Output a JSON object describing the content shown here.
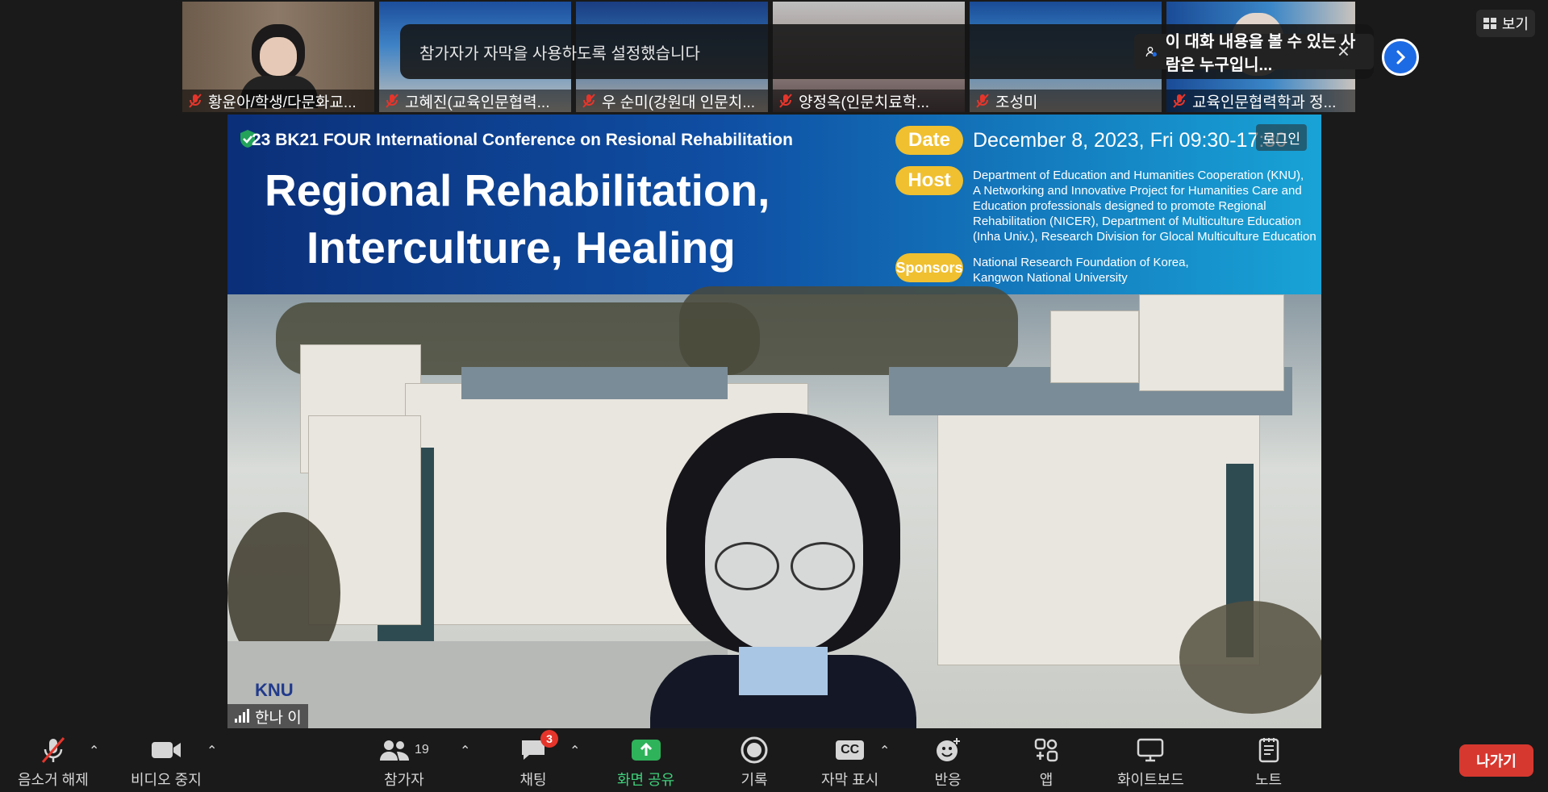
{
  "gallery": [
    {
      "name": "황윤아/학생/다문화교..."
    },
    {
      "name": "고혜진(교육인문협력..."
    },
    {
      "name": "우 순미(강원대 인문치..."
    },
    {
      "name": "양정옥(인문치료학..."
    },
    {
      "name": "조성미"
    },
    {
      "name": "교육인문협력학과 정..."
    }
  ],
  "caption_banner": {
    "text": "참가자가 자막을 사용하도록 설정했습니다",
    "who_can_see": "이 대화 내용을 볼 수 있는 사람은 누구입니...",
    "close": "×"
  },
  "view_button": {
    "label": "보기"
  },
  "shared_screen": {
    "conference": "23 BK21 FOUR International Conference on Resional Rehabilitation",
    "title_line1": "Regional Rehabilitation,",
    "title_line2": "Interculture, Healing",
    "date_tag": "Date",
    "date_text": "December 8, 2023, Fri 09:30-17:30",
    "host_tag": "Host",
    "host_text_1": "Department of Education and Humanities Cooperation (KNU),",
    "host_text_2": "A Networking and Innovative Project for Humanities Care and",
    "host_text_3": "Education professionals designed to promote Regional",
    "host_text_4": "Rehabilitation (NICER), Department of Multiculture Education",
    "host_text_5": "(Inha Univ.), Research Division for Glocal Multiculture Education",
    "sponsor_tag": "Sponsors",
    "sponsor_text_1": "National Research Foundation of Korea,",
    "sponsor_text_2": "Kangwon National University",
    "login_label": "로그인",
    "logo_text": "KNU"
  },
  "speaker": {
    "name": "한나 이"
  },
  "toolbar": {
    "mute": "음소거 해제",
    "video": "비디오 중지",
    "participants": "참가자",
    "participants_count": "19",
    "chat": "채팅",
    "chat_badge": "3",
    "share": "화면 공유",
    "record": "기록",
    "captions": "자막 표시",
    "captions_icon": "CC",
    "reactions": "반응",
    "apps": "앱",
    "whiteboard": "화이트보드",
    "notes": "노트",
    "leave": "나가기"
  },
  "colors": {
    "accent": "#1d6ae5",
    "leave": "#d6382f",
    "share": "#2fb35a",
    "muted": "#e5352b"
  }
}
